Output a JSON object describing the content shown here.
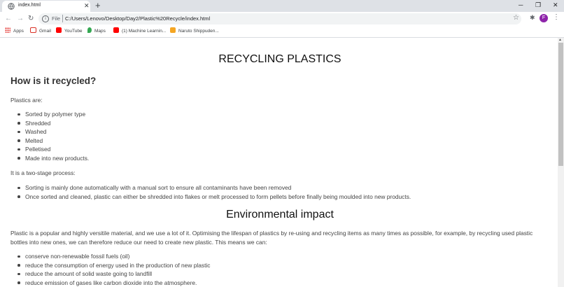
{
  "browser": {
    "tab_title": "index.html",
    "new_tab": "+",
    "tab_close": "✕",
    "win_min": "─",
    "win_max": "❐",
    "win_close": "✕",
    "scheme_label": "File",
    "url": "C:/Users/Lenovo/Desktop/Day2/Plastic%20Recycle/index.html",
    "avatar_letter": "F",
    "bookmarks": [
      "Apps",
      "Gmail",
      "YouTube",
      "Maps",
      "(1) Machine Learnin...",
      "Naruto Shippuden..."
    ]
  },
  "page": {
    "title": "RECYCLING PLASTICS",
    "section1_heading": "How is it recycled?",
    "plastics_intro": "Plastics are:",
    "plastics_steps": [
      "Sorted by polymer type",
      "Shredded",
      "Washed",
      "Melted",
      "Pelletised",
      "Made into new products."
    ],
    "process_intro": "It is a two-stage process:",
    "process_steps": [
      "Sorting is mainly done automatically with a manual sort to ensure all contaminants have been removed",
      "Once sorted and cleaned, plastic can either be shredded into flakes or melt processed to form pellets before finally being moulded into new products."
    ],
    "section2_heading": "Environmental impact",
    "impact_paragraph": "Plastic is a popular and highly versitile material, and we use a lot of it. Optimising the lifespan of plastics by re-using and recycling items as many times as possible, for example, by recycling used plastic bottles into new ones, we can therefore reduce our need to create new plastic. This means we can:",
    "impact_points": [
      "conserve non-renewable fossil fuels (oil)",
      "reduce the consumption of energy used in the production of new plastic",
      "reduce the amount of solid waste going to landfill",
      "reduce emission of gases like carbon dioxide into the atmosphere."
    ]
  },
  "colors": {
    "tabstrip": "#dee1e6",
    "omnibox": "#f1f3f4",
    "avatar": "#8e24aa"
  }
}
